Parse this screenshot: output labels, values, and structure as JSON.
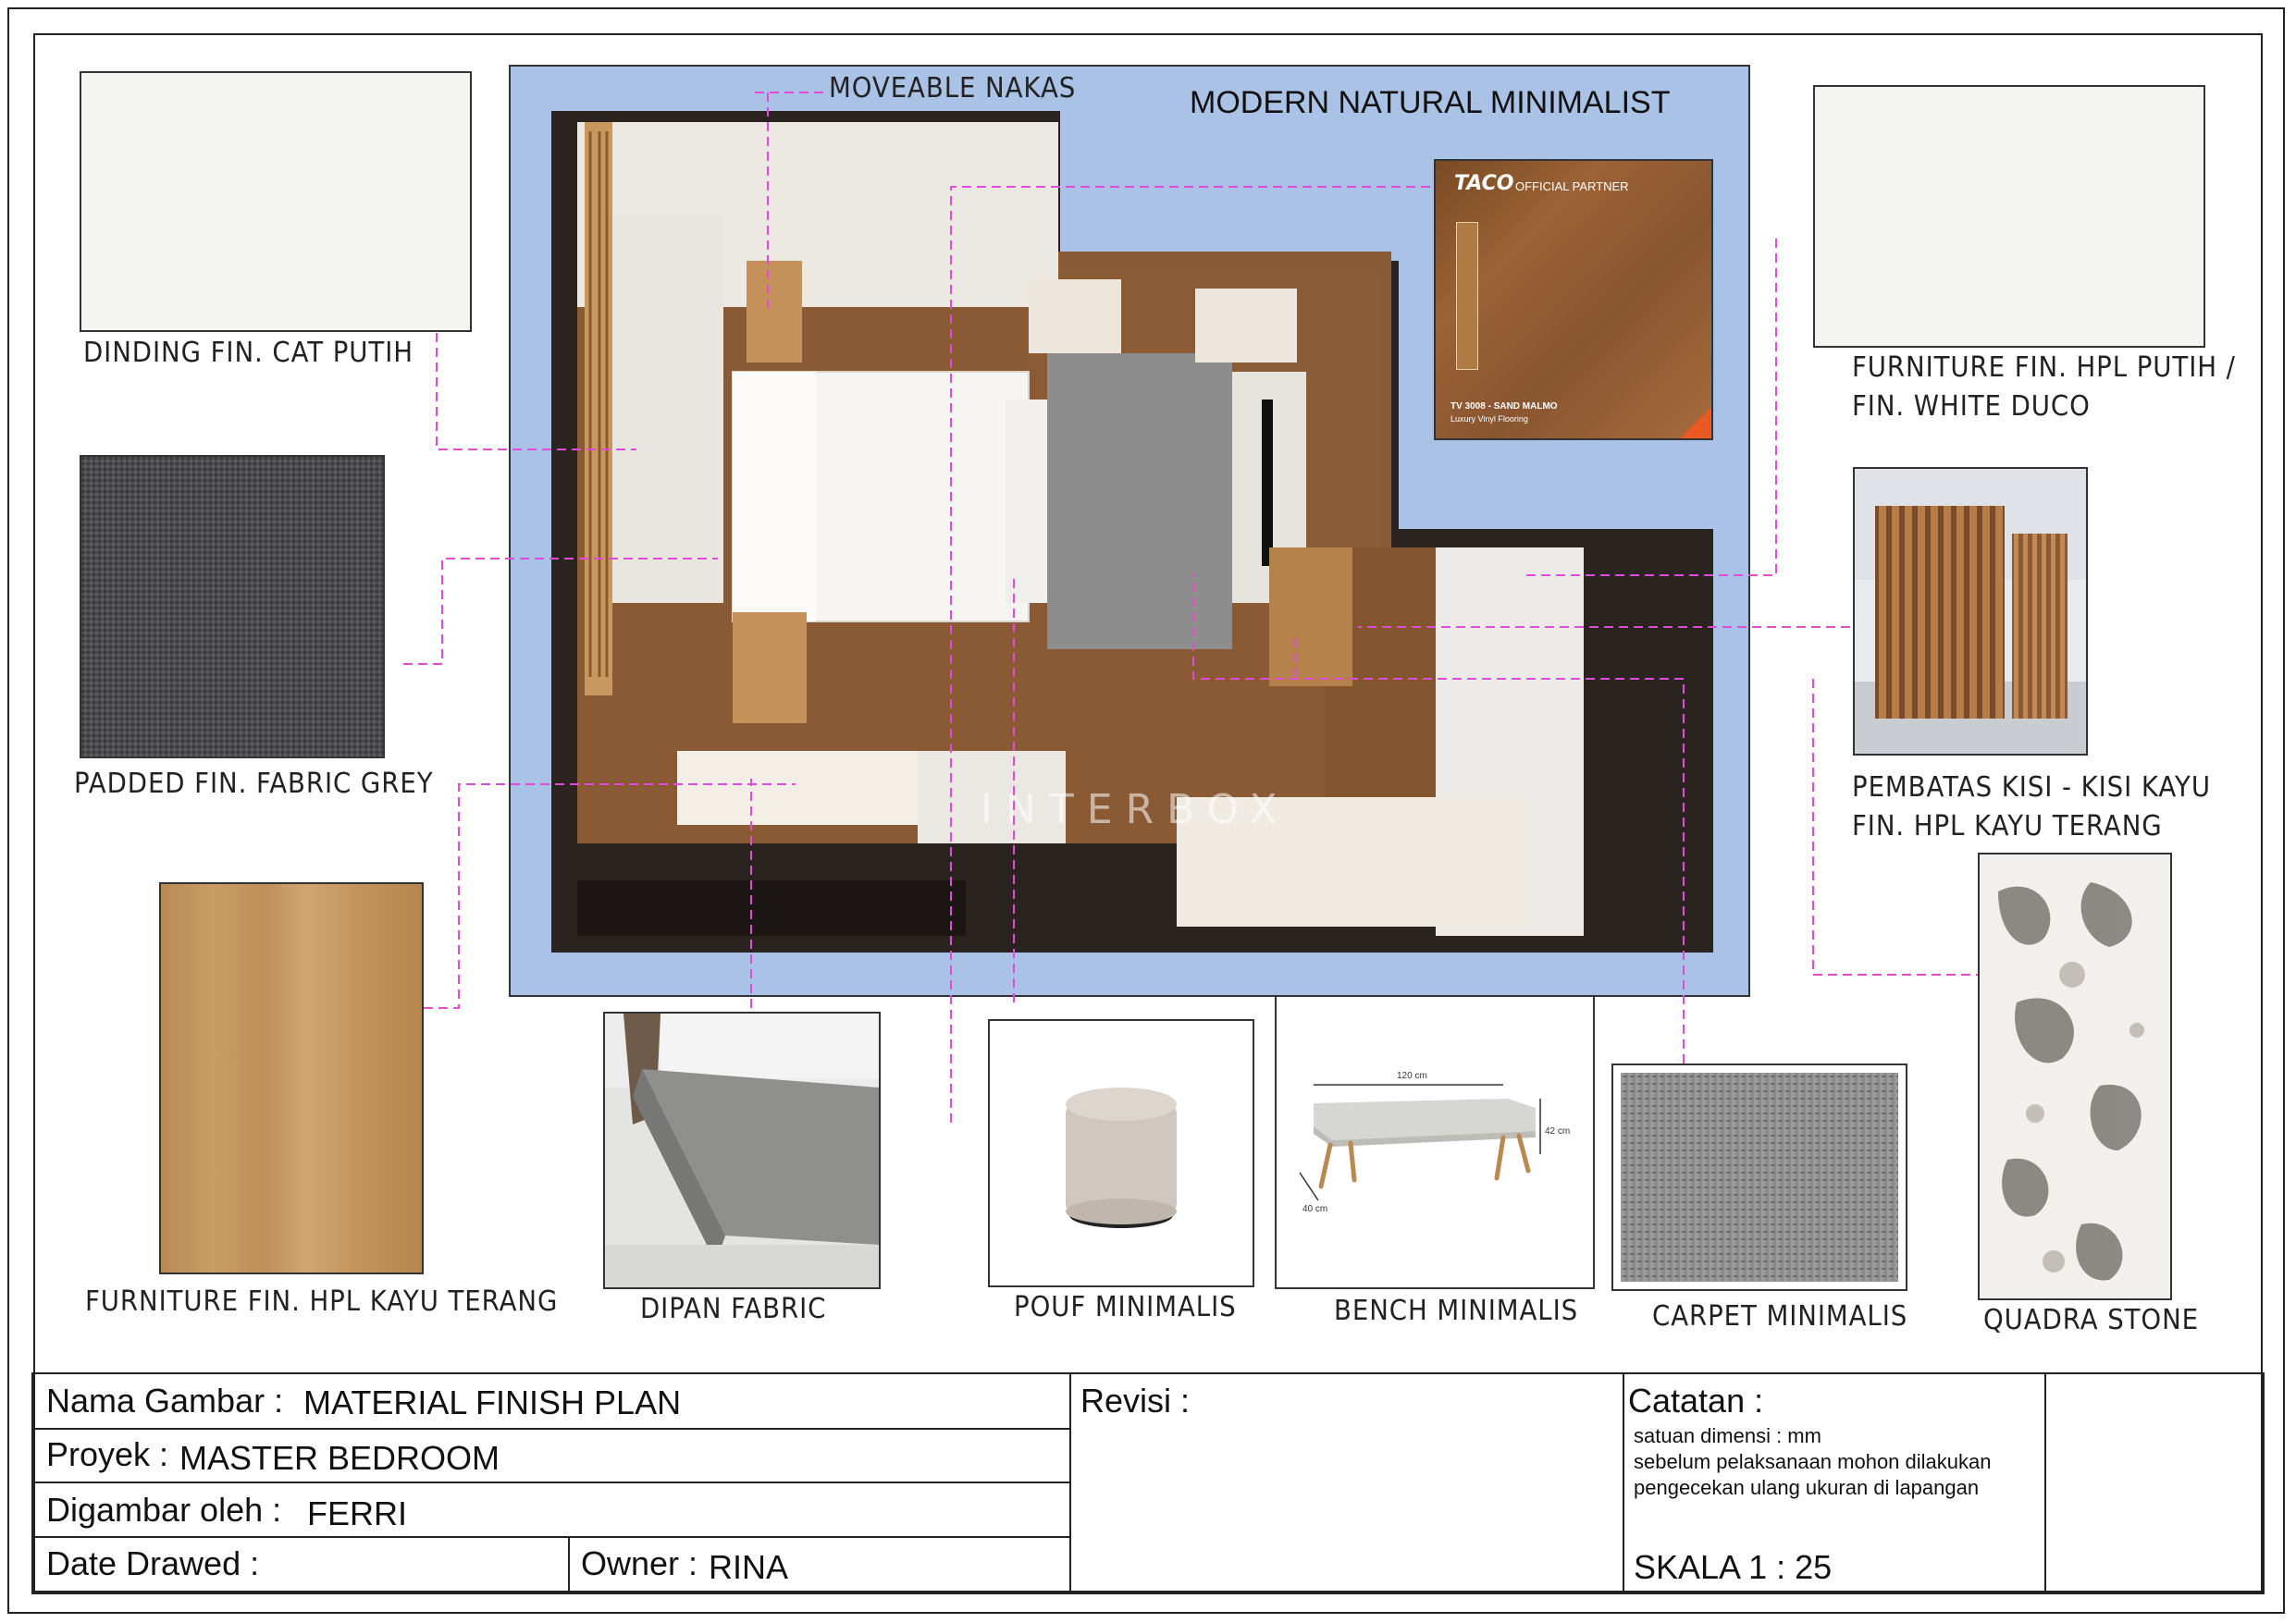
{
  "plan": {
    "style_title": "MODERN NATURAL MINIMALIST",
    "watermark": "INTERBOX",
    "callout_nakas": "MOVEABLE NAKAS"
  },
  "flooring_card": {
    "brand": "TACO",
    "partner": "OFFICIAL PARTNER",
    "product": "TV 3008 - SAND MALMO",
    "subtitle": "Luxury Vinyl Flooring"
  },
  "materials": {
    "wall_paint": "DINDING FIN. CAT PUTIH",
    "padded_fabric": "PADDED FIN. FABRIC GREY",
    "furniture_wood": "FURNITURE FIN. HPL KAYU TERANG",
    "furniture_white_line1": "FURNITURE FIN. HPL PUTIH /",
    "furniture_white_line2": "FIN. WHITE DUCO",
    "partition_line1": "PEMBATAS KISI - KISI KAYU",
    "partition_line2": "FIN. HPL KAYU TERANG",
    "dipan": "DIPAN FABRIC",
    "pouf": "POUF MINIMALIS",
    "bench": "BENCH MINIMALIS",
    "carpet": "CARPET MINIMALIS",
    "stone": "QUADRA STONE"
  },
  "bench_dims": {
    "length": "120 cm",
    "height": "42 cm",
    "depth": "40 cm"
  },
  "title_block": {
    "nama_gambar_label": "Nama Gambar :",
    "nama_gambar_value": "MATERIAL FINISH PLAN",
    "proyek_label": "Proyek :",
    "proyek_value": "MASTER BEDROOM",
    "digambar_label": "Digambar oleh :",
    "digambar_value": "FERRI",
    "date_label": "Date Drawed :",
    "owner_label": "Owner :",
    "owner_value": "RINA",
    "revisi_label": "Revisi :",
    "catatan_label": "Catatan :",
    "note_1": "satuan dimensi : mm",
    "note_2": "sebelum pelaksanaan mohon dilakukan",
    "note_3": "pengecekan ulang ukuran di lapangan",
    "skala": "SKALA 1 : 25"
  },
  "colors": {
    "plan_background": "#a9c2e6",
    "wood_floor": "#8a5a35",
    "leader_line": "#e04bd8",
    "grey_fabric": "#4a4a4c",
    "light_wood": "#c79a62"
  }
}
